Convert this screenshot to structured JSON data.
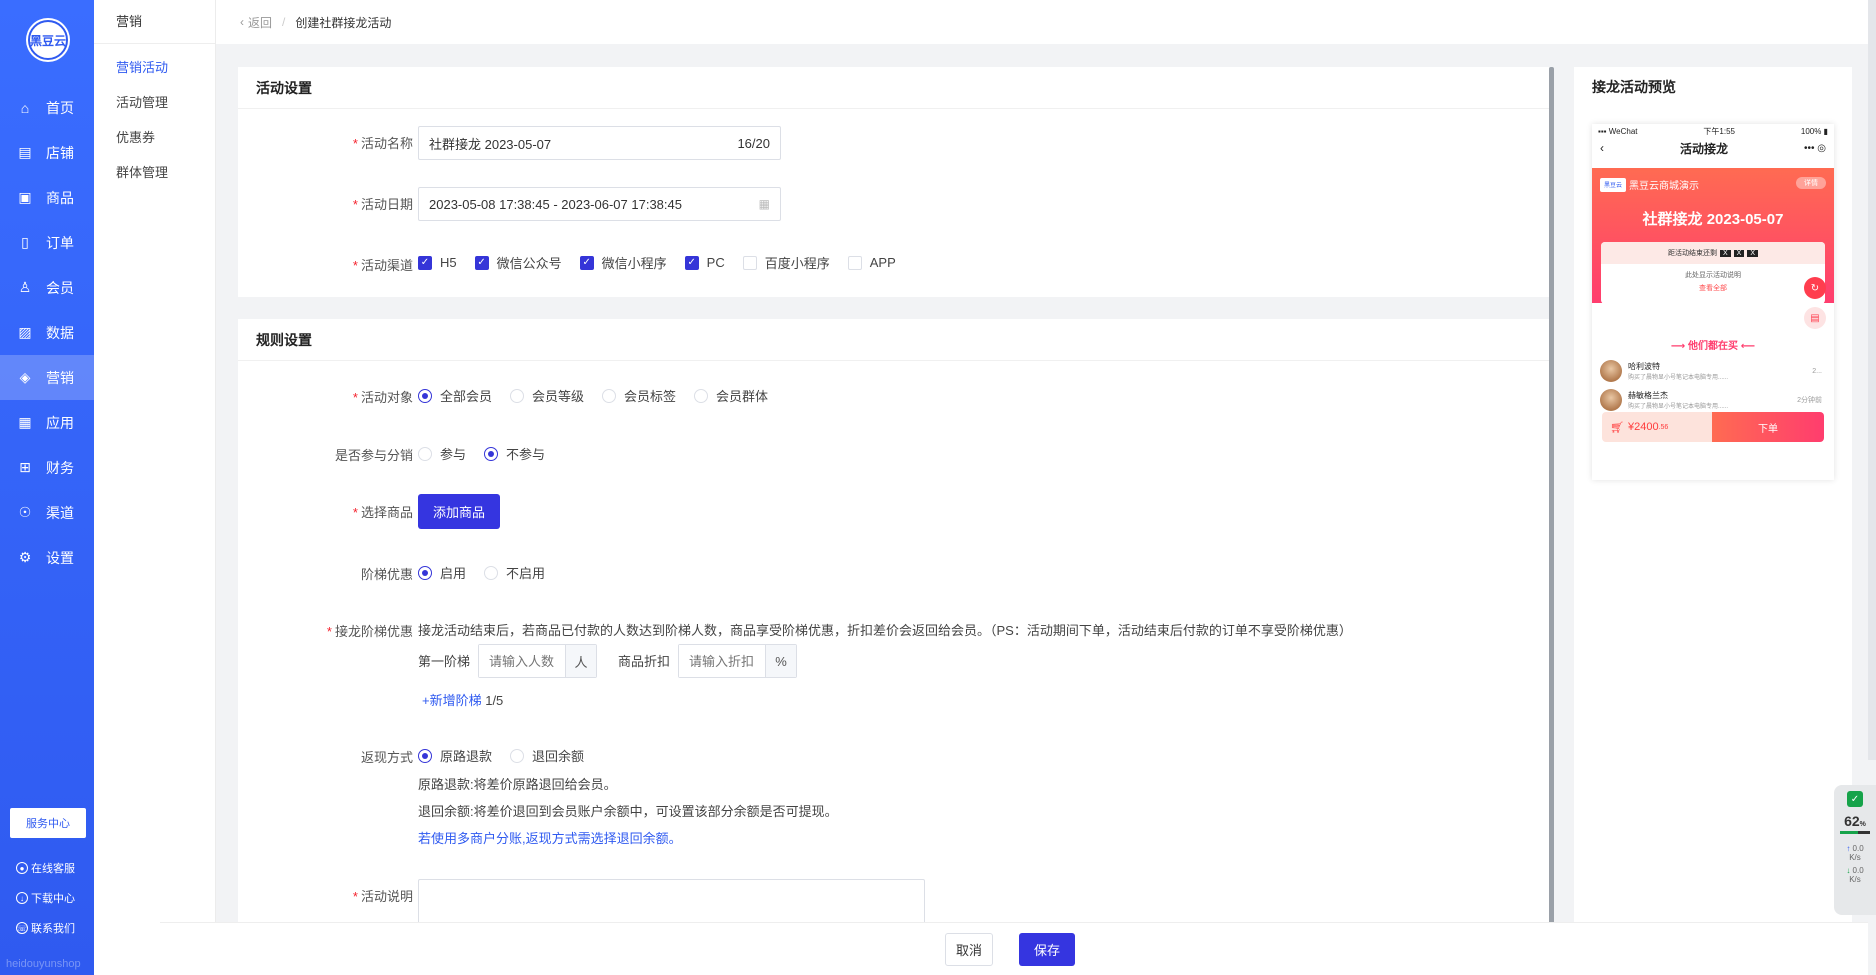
{
  "brand": {
    "logo_text": "黑豆云",
    "watermark": "heidouyunshop"
  },
  "nav": [
    {
      "label": "首页",
      "icon": "home-icon",
      "glyph": "⌂"
    },
    {
      "label": "店铺",
      "icon": "store-icon",
      "glyph": "▤"
    },
    {
      "label": "商品",
      "icon": "goods-icon",
      "glyph": "▣"
    },
    {
      "label": "订单",
      "icon": "order-icon",
      "glyph": "▯"
    },
    {
      "label": "会员",
      "icon": "member-icon",
      "glyph": "♙"
    },
    {
      "label": "数据",
      "icon": "data-icon",
      "glyph": "▨"
    },
    {
      "label": "营销",
      "icon": "marketing-icon",
      "glyph": "◈"
    },
    {
      "label": "应用",
      "icon": "apps-icon",
      "glyph": "▦"
    },
    {
      "label": "财务",
      "icon": "finance-icon",
      "glyph": "⊞"
    },
    {
      "label": "渠道",
      "icon": "channel-icon",
      "glyph": "☉"
    },
    {
      "label": "设置",
      "icon": "settings-icon",
      "glyph": "⚙"
    }
  ],
  "service_center": "服务中心",
  "side_links": [
    {
      "label": "在线客服",
      "icon": "chat-icon",
      "glyph": "●"
    },
    {
      "label": "下载中心",
      "icon": "download-icon",
      "glyph": "↓"
    },
    {
      "label": "联系我们",
      "icon": "contact-icon",
      "glyph": "☏"
    }
  ],
  "subnav": {
    "title": "营销",
    "items": [
      "营销活动",
      "活动管理",
      "优惠券",
      "群体管理"
    ]
  },
  "breadcrumb": {
    "back": "返回",
    "current": "创建社群接龙活动"
  },
  "section_activity": {
    "title": "活动设置",
    "name_label": "活动名称",
    "name_value": "社群接龙  2023-05-07",
    "name_count": "16/20",
    "date_label": "活动日期",
    "date_value": "2023-05-08 17:38:45 - 2023-06-07 17:38:45",
    "channel_label": "活动渠道",
    "channels": [
      {
        "label": "H5",
        "checked": true
      },
      {
        "label": "微信公众号",
        "checked": true
      },
      {
        "label": "微信小程序",
        "checked": true
      },
      {
        "label": "PC",
        "checked": true
      },
      {
        "label": "百度小程序",
        "checked": false
      },
      {
        "label": "APP",
        "checked": false
      }
    ]
  },
  "section_rules": {
    "title": "规则设置",
    "target_label": "活动对象",
    "targets": [
      {
        "label": "全部会员",
        "selected": true
      },
      {
        "label": "会员等级",
        "selected": false
      },
      {
        "label": "会员标签",
        "selected": false
      },
      {
        "label": "会员群体",
        "selected": false
      }
    ],
    "distribution_label": "是否参与分销",
    "distribution": [
      {
        "label": "参与",
        "selected": false
      },
      {
        "label": "不参与",
        "selected": true
      }
    ],
    "goods_label": "选择商品",
    "goods_button": "添加商品",
    "tier_label": "阶梯优惠",
    "tier": [
      {
        "label": "启用",
        "selected": true
      },
      {
        "label": "不启用",
        "selected": false
      }
    ],
    "tier_discount_label": "接龙阶梯优惠",
    "tier_desc": "接龙活动结束后，若商品已付款的人数达到阶梯人数，商品享受阶梯优惠，折扣差价会返回给会员。（PS：活动期间下单，活动结束后付款的订单不享受阶梯优惠）",
    "first_tier_label": "第一阶梯",
    "people_placeholder": "请输入人数",
    "people_unit": "人",
    "discount_label": "商品折扣",
    "discount_placeholder": "请输入折扣",
    "discount_unit": "%",
    "add_tier": "+新增阶梯",
    "tier_count": "1/5",
    "refund_label": "返现方式",
    "refund": [
      {
        "label": "原路退款",
        "selected": true
      },
      {
        "label": "退回余额",
        "selected": false
      }
    ],
    "refund_note1": "原路退款:将差价原路退回给会员。",
    "refund_note2": "退回余额:将差价退回到会员账户余额中，可设置该部分余额是否可提现。",
    "refund_note3": "若使用多商户分账,返现方式需选择退回余额。",
    "desc_label": "活动说明"
  },
  "footer": {
    "cancel": "取消",
    "save": "保存"
  },
  "preview": {
    "title": "接龙活动预览",
    "status_left": "WeChat",
    "status_time": "下午1:55",
    "status_battery": "100%",
    "nav_title": "活动接龙",
    "shop_logo": "黑豆云",
    "shop_name": "黑豆云商城演示",
    "tag": "详情",
    "headline": "社群接龙 2023-05-07",
    "countdown_label": "距活动结束还剩",
    "countdown": [
      "X",
      "X",
      "X"
    ],
    "note": "此处显示活动说明",
    "see_all": "查看全部",
    "buying": "他们都在买",
    "users": [
      {
        "name": "哈利波特",
        "desc": "购买了晨物显小号笔记本电脑专用......",
        "time": "2..."
      },
      {
        "name": "赫敏格兰杰",
        "desc": "购买了晨物显小号笔记本电脑专用......",
        "time": "2分钟前"
      }
    ],
    "price": "¥2400",
    "price_cents": ".56",
    "buy": "下单"
  },
  "net_widget": {
    "percent": "62",
    "percent_unit": "%",
    "up": "0.0",
    "down": "0.0",
    "unit": "K/s"
  }
}
